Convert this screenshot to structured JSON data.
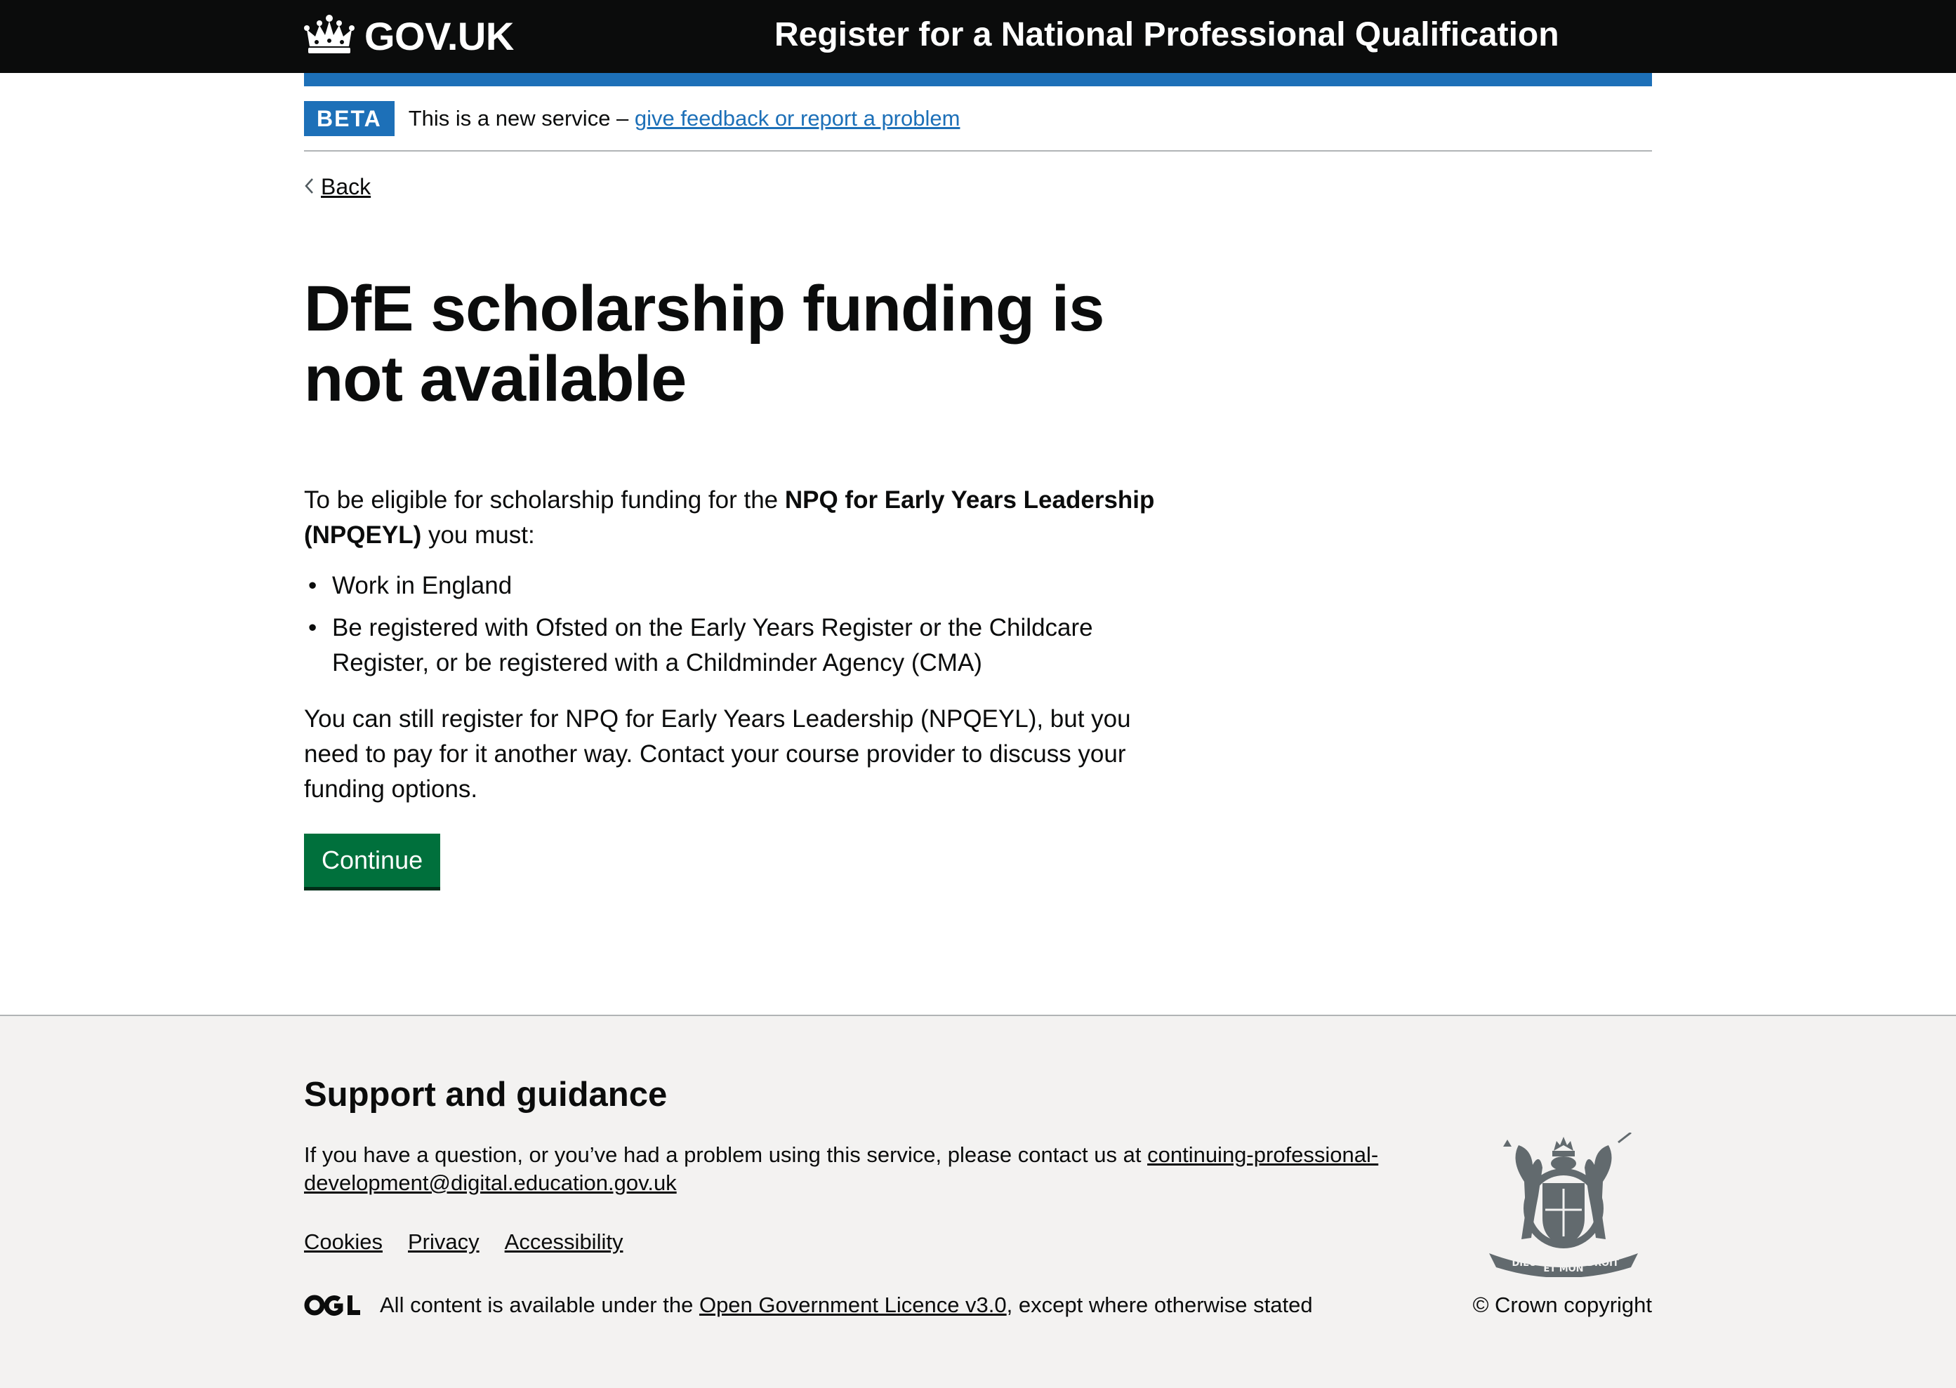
{
  "header": {
    "logo_text": "GOV.UK",
    "service_name": "Register for a National Professional Qualification"
  },
  "phase_banner": {
    "tag": "BETA",
    "text": "This is a new service – ",
    "link": "give feedback or report a problem"
  },
  "back_link": "Back",
  "main": {
    "title": "DfE scholarship funding is not available",
    "intro_before": "To be eligible for scholarship funding for the ",
    "intro_bold": "NPQ for Early Years Leadership (NPQEYL)",
    "intro_after": " you must:",
    "requirements": [
      "Work in England",
      "Be registered with Ofsted on the Early Years Register or the Childcare Register, or be registered with a Childminder Agency (CMA)"
    ],
    "note": "You can still register for NPQ for Early Years Leadership (NPQEYL), but you need to pay for it another way. Contact your course provider to discuss your funding options.",
    "continue_label": "Continue"
  },
  "footer": {
    "heading": "Support and guidance",
    "support_text": "If you have a question, or you’ve had a problem using this service, please contact us at ",
    "support_email": "continuing-professional-development@digital.education.gov.uk",
    "links": [
      "Cookies",
      "Privacy",
      "Accessibility"
    ],
    "licence_before": "All content is available under the ",
    "licence_link": "Open Government Licence v3.0",
    "licence_after": ", except where otherwise stated",
    "copyright": "© Crown copyright",
    "crest_mottos": [
      "DIEU",
      "ET MON",
      "DROIT"
    ]
  },
  "colors": {
    "header_bg": "#0b0c0c",
    "brand_blue": "#1d70b8",
    "button_green": "#00703c",
    "footer_bg": "#f3f2f1"
  },
  "icons": [
    "crown-icon",
    "chevron-left-icon",
    "ogl-logo",
    "royal-coat-of-arms"
  ]
}
